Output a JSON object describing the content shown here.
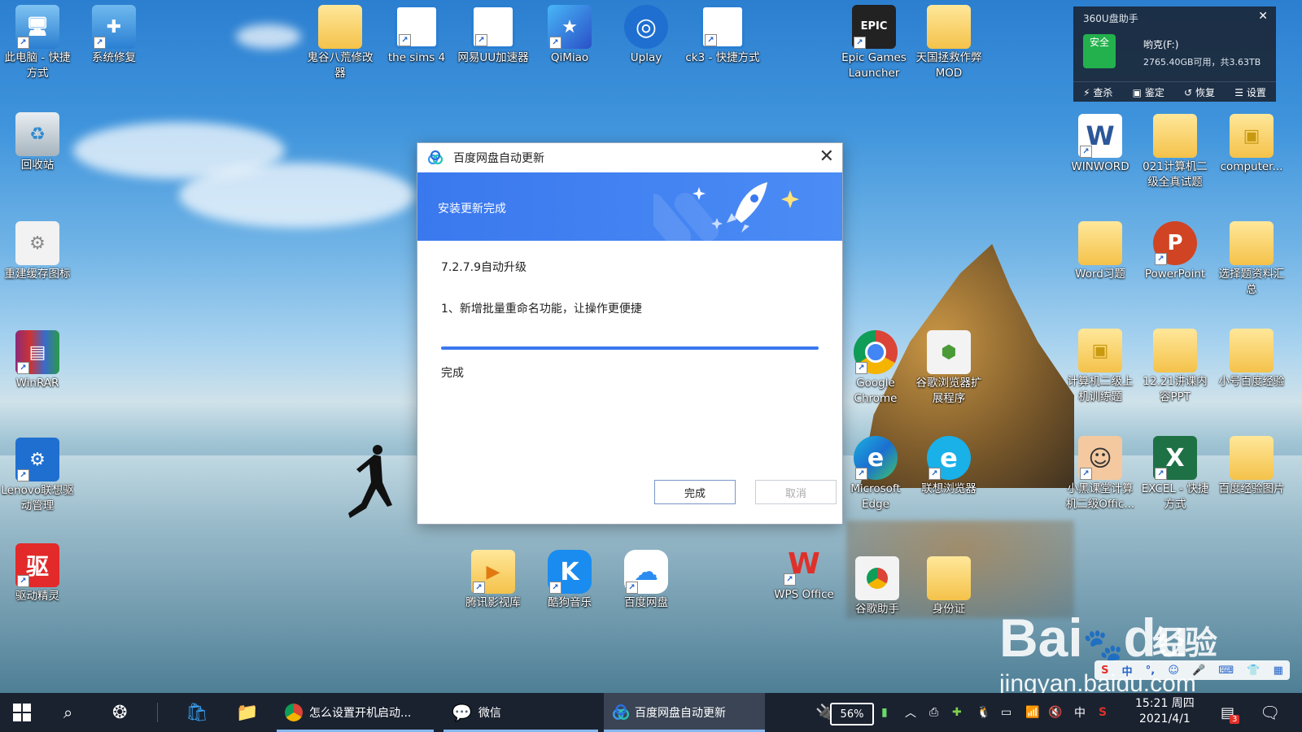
{
  "desktop_icons": {
    "this_pc": "此电脑 - 快捷方式",
    "system_repair": "系统修复",
    "ghost_mod": "鬼谷八荒修改器",
    "sims": "the sims 4",
    "uu": "网易UU加速器",
    "qimiao": "QiMiao",
    "uplay": "Uplay",
    "ck3": "ck3 - 快捷方式",
    "epic": "Epic Games Launcher",
    "tianguo": "天国拯救作弊MOD",
    "recycle": "回收站",
    "rebuild_cache": "重建缓存图标",
    "winrar": "WinRAR",
    "lenovo_driver": "Lenovo联想驱动管理",
    "driver_genius": "驱动精灵",
    "winword": "WINWORD",
    "exam021": "021计算机二级全真试题",
    "computer": "computer...",
    "word_practice": "Word习题",
    "powerpoint": "PowerPoint",
    "choice_material": "选择题资料汇总",
    "computer2_practice": "计算机二级上机训练题",
    "ppt1221": "12.21讲课内容PPT",
    "xiaohao_baidu": "小号百度经验",
    "xiaohei": "小黑课堂计算机二级Offic...",
    "excel": "EXCEL - 快捷方式",
    "baidu_exp_img": "百度经验图片",
    "google_chrome": "Google Chrome",
    "chrome_ext": "谷歌浏览器扩展程序",
    "edge": "Microsoft Edge",
    "lenovo_browser": "联想浏览器",
    "tencent_video": "腾讯影视库",
    "kugou": "酷狗音乐",
    "baidu_pan": "百度网盘",
    "wps": "WPS Office",
    "google_helper": "谷歌助手",
    "id_card": "身份证"
  },
  "widget360": {
    "title": "360U盘助手",
    "safe_label": "安全",
    "drive_name": "哟克(F:)",
    "drive_info": "2765.40GB可用，共3.63TB",
    "actions": [
      "查杀",
      "鉴定",
      "恢复",
      "设置"
    ]
  },
  "dialog": {
    "title": "百度网盘自动更新",
    "banner_text": "安装更新完成",
    "version_line": "7.2.7.9自动升级",
    "note": "1、新增批量重命名功能，让操作更便捷",
    "progress": 1.0,
    "status": "完成",
    "ok_label": "完成",
    "cancel_label": "取消"
  },
  "watermark": {
    "brand": "Bai",
    "brand_du": "du",
    "cn": "经验",
    "url": "jingyan.baidu.com"
  },
  "ime": [
    "中",
    "°,",
    "☺",
    "🎤",
    "⌨",
    "👕",
    "▦"
  ],
  "taskbar": {
    "tasks": [
      {
        "label": "怎么设置开机启动..."
      },
      {
        "label": "微信"
      },
      {
        "label": "百度网盘自动更新"
      }
    ],
    "battery": "56%",
    "ime_mode": "中",
    "time": "15:21 周四",
    "date": "2021/4/1",
    "notif_count": "3"
  },
  "colors": {
    "dialog_accent": "#3a78ee",
    "taskbar_bg": "#1a2230",
    "safe_green": "#23b14d"
  }
}
